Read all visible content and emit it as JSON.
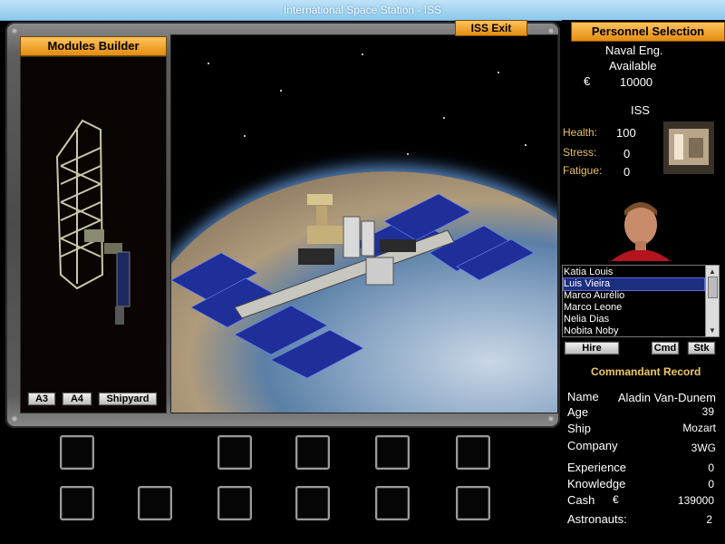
{
  "window": {
    "title": "International Space Station - ISS"
  },
  "modules_builder": {
    "header": "Modules Builder",
    "buttons": [
      "A3",
      "A4",
      "Shipyard"
    ]
  },
  "viewport": {
    "exit_label": "ISS Exit"
  },
  "personnel": {
    "header": "Personnel Selection",
    "role": "Naval Eng.",
    "status": "Available",
    "currency": "€",
    "cost": "10000",
    "location": "ISS",
    "stats": [
      {
        "label": "Health:",
        "value": "100"
      },
      {
        "label": "Stress:",
        "value": "0"
      },
      {
        "label": "Fatigue:",
        "value": "0"
      }
    ],
    "candidates": [
      "Katia Louis",
      "Luis Vieira",
      "Marco Aurélio",
      "Marco Leone",
      "Nelia Dias",
      "Nobita Noby"
    ],
    "selected_index": 1,
    "buttons": {
      "hire": "Hire",
      "cmd": "Cmd",
      "stk": "Stk"
    }
  },
  "commandant": {
    "header": "Commandant Record",
    "name_label": "Name",
    "name": "Aladin Van-Dunem",
    "age_label": "Age",
    "age": "39",
    "ship_label": "Ship",
    "ship": "Mozart",
    "company_label": "Company",
    "company": "3WG",
    "experience_label": "Experience",
    "experience": "0",
    "knowledge_label": "Knowledge",
    "knowledge": "0",
    "cash_label": "Cash",
    "cash_currency": "€",
    "cash": "139000",
    "astronauts_label": "Astronauts:",
    "astronauts": "2"
  },
  "colors": {
    "accent": "#f0a030",
    "selection": "#1b2e80",
    "label": "#e8c060"
  }
}
